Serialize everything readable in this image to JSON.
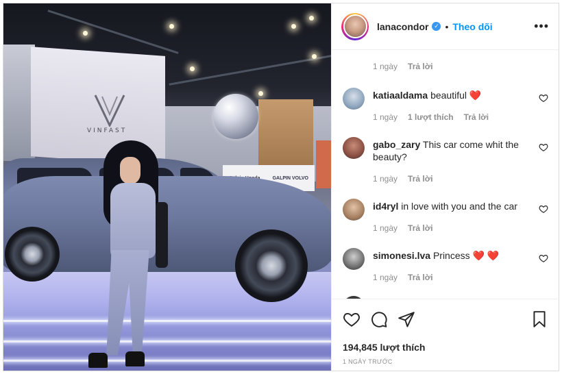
{
  "post": {
    "username": "lanacondor",
    "verified": true,
    "follow_label": "Theo dõi",
    "separator": "•",
    "more_label": "•••"
  },
  "photo": {
    "brand_text": "VINFAST",
    "sponsor_left": "Galpin Honda",
    "sponsor_right": "GALPIN VOLVO"
  },
  "first_comment_meta": {
    "time": "1 ngày",
    "reply": "Trả lời"
  },
  "comments": [
    {
      "user": "katiaaldama",
      "text": "beautiful",
      "emoji": "❤️",
      "time": "1 ngày",
      "likes": "1 lượt thích",
      "reply": "Trả lời"
    },
    {
      "user": "gabo_zary",
      "text": "This car come whit the beauty?",
      "emoji": "",
      "time": "1 ngày",
      "likes": "",
      "reply": "Trả lời"
    },
    {
      "user": "id4ryl",
      "text": "in love with you and the car",
      "emoji": "",
      "time": "1 ngày",
      "likes": "",
      "reply": "Trả lời"
    },
    {
      "user": "simonesi.lva",
      "text": "Princess",
      "emoji": "❤️ ❤️",
      "time": "1 ngày",
      "likes": "",
      "reply": "Trả lời"
    }
  ],
  "footer": {
    "likes": "194,845 lượt thích",
    "timestamp": "1 NGÀY TRƯỚC"
  },
  "icons": [
    "heart-icon",
    "comment-icon",
    "share-icon",
    "bookmark-icon",
    "more-icon",
    "verified-icon"
  ],
  "colors": {
    "link_blue": "#0095f6",
    "verified_blue": "#3897f0",
    "heart_red": "#e0245e",
    "muted_gray": "#8e8e8e"
  }
}
